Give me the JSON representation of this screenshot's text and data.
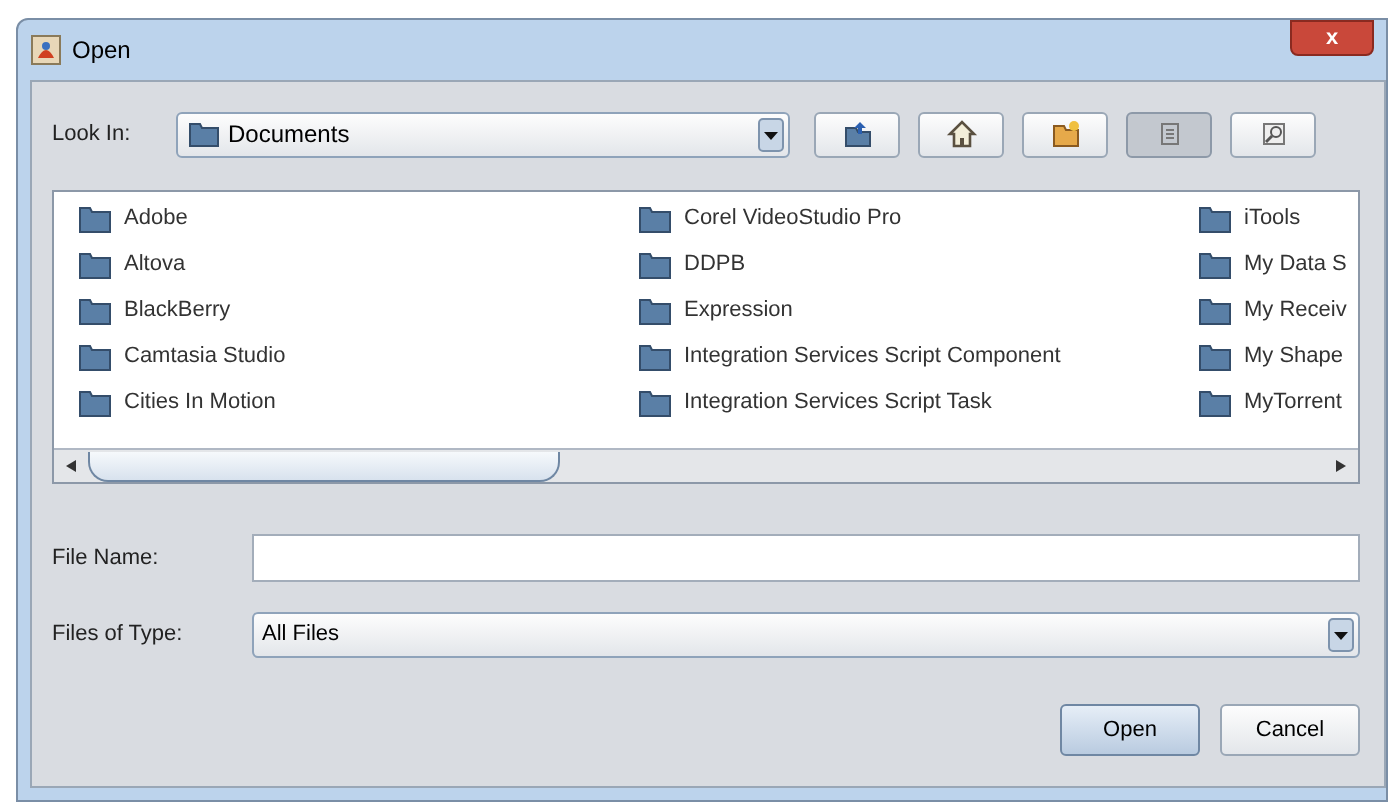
{
  "window": {
    "title": "Open",
    "close": "x"
  },
  "look_in": {
    "label": "Look In:",
    "value": "Documents"
  },
  "toolbar": [
    {
      "kind": "up",
      "selected": false
    },
    {
      "kind": "home",
      "selected": false
    },
    {
      "kind": "newfolder",
      "selected": false
    },
    {
      "kind": "list",
      "selected": true
    },
    {
      "kind": "details",
      "selected": false
    }
  ],
  "files": [
    {
      "name": "Adobe"
    },
    {
      "name": "Altova"
    },
    {
      "name": "BlackBerry"
    },
    {
      "name": "Camtasia Studio"
    },
    {
      "name": "Cities In Motion"
    },
    {
      "name": "Corel VideoStudio Pro"
    },
    {
      "name": "DDPB"
    },
    {
      "name": "Expression"
    },
    {
      "name": "Integration Services Script Component"
    },
    {
      "name": "Integration Services Script Task"
    },
    {
      "name": "iTools"
    },
    {
      "name": "My Data S"
    },
    {
      "name": "My Receiv"
    },
    {
      "name": "My Shape"
    },
    {
      "name": "MyTorrent"
    }
  ],
  "file_name": {
    "label": "File Name:"
  },
  "files_of_type": {
    "label": "Files of Type:",
    "value": "All Files"
  },
  "buttons": [
    {
      "label": "Open",
      "selected": true
    },
    {
      "label": "Cancel",
      "selected": false
    }
  ]
}
